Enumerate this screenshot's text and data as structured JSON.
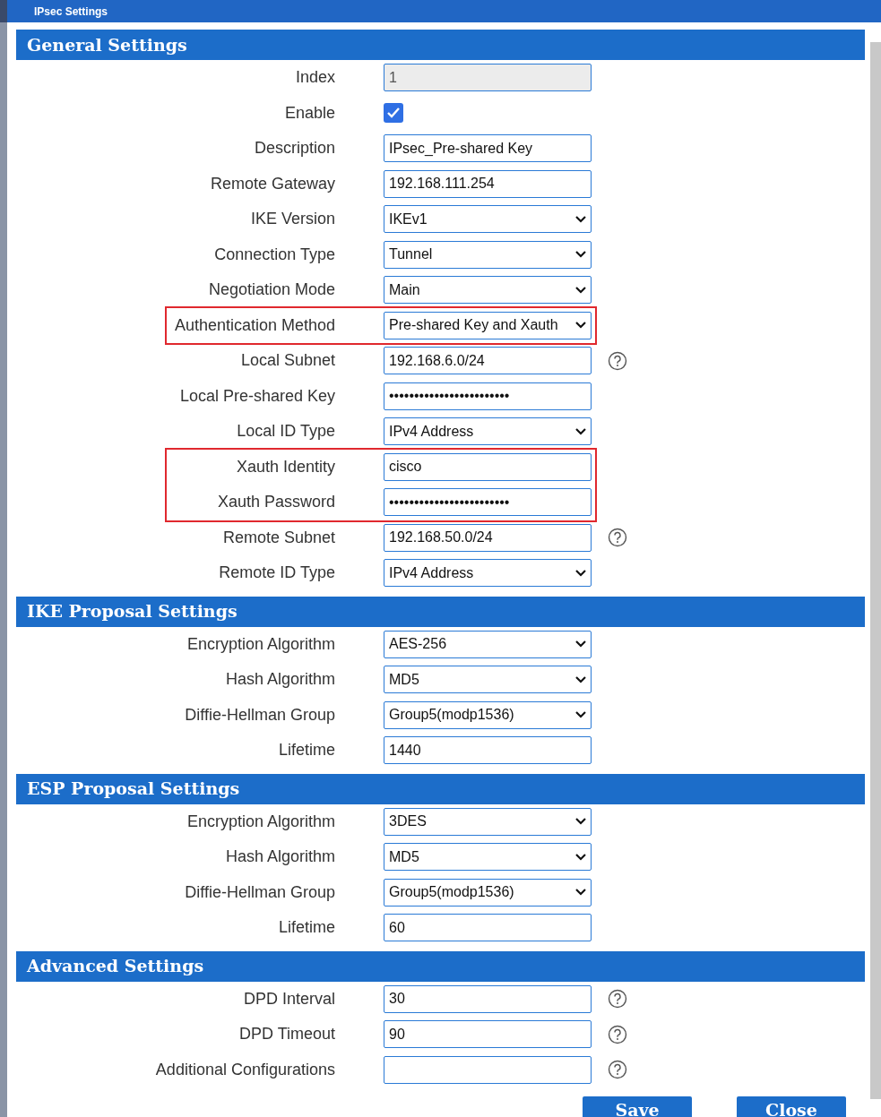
{
  "window": {
    "title": "IPsec Settings"
  },
  "sections": [
    {
      "title": "General Settings",
      "rows": [
        {
          "kind": "text",
          "label": "Index",
          "value": "1",
          "disabled": true
        },
        {
          "kind": "checkbox",
          "label": "Enable",
          "checked": true
        },
        {
          "kind": "text",
          "label": "Description",
          "value": "IPsec_Pre-shared Key"
        },
        {
          "kind": "text",
          "label": "Remote Gateway",
          "value": "192.168.111.254"
        },
        {
          "kind": "select",
          "label": "IKE Version",
          "value": "IKEv1"
        },
        {
          "kind": "select",
          "label": "Connection Type",
          "value": "Tunnel"
        },
        {
          "kind": "select",
          "label": "Negotiation Mode",
          "value": "Main"
        },
        {
          "kind": "group",
          "highlighted": true,
          "rows": [
            {
              "kind": "select",
              "label": "Authentication Method",
              "value": "Pre-shared Key and Xauth"
            }
          ]
        },
        {
          "kind": "text",
          "label": "Local Subnet",
          "value": "192.168.6.0/24",
          "help": true
        },
        {
          "kind": "password",
          "label": "Local Pre-shared Key",
          "value": "••••••••••••••••••••••••"
        },
        {
          "kind": "select",
          "label": "Local ID Type",
          "value": "IPv4 Address"
        },
        {
          "kind": "group",
          "highlighted": true,
          "rows": [
            {
              "kind": "text",
              "label": "Xauth Identity",
              "value": "cisco"
            },
            {
              "kind": "password",
              "label": "Xauth Password",
              "value": "••••••••••••••••••••••••"
            }
          ]
        },
        {
          "kind": "text",
          "label": "Remote Subnet",
          "value": "192.168.50.0/24",
          "help": true
        },
        {
          "kind": "select",
          "label": "Remote ID Type",
          "value": "IPv4 Address"
        }
      ]
    },
    {
      "title": "IKE Proposal Settings",
      "rows": [
        {
          "kind": "select",
          "label": "Encryption Algorithm",
          "value": "AES-256"
        },
        {
          "kind": "select",
          "label": "Hash Algorithm",
          "value": "MD5"
        },
        {
          "kind": "select",
          "label": "Diffie-Hellman Group",
          "value": "Group5(modp1536)"
        },
        {
          "kind": "text",
          "label": "Lifetime",
          "value": "1440"
        }
      ]
    },
    {
      "title": "ESP Proposal Settings",
      "rows": [
        {
          "kind": "select",
          "label": "Encryption Algorithm",
          "value": "3DES"
        },
        {
          "kind": "select",
          "label": "Hash Algorithm",
          "value": "MD5"
        },
        {
          "kind": "select",
          "label": "Diffie-Hellman Group",
          "value": "Group5(modp1536)"
        },
        {
          "kind": "text",
          "label": "Lifetime",
          "value": "60"
        }
      ]
    },
    {
      "title": "Advanced Settings",
      "rows": [
        {
          "kind": "text",
          "label": "DPD Interval",
          "value": "30",
          "help": true
        },
        {
          "kind": "text",
          "label": "DPD Timeout",
          "value": "90",
          "help": true
        },
        {
          "kind": "text",
          "label": "Additional Configurations",
          "help": true
        }
      ]
    }
  ],
  "buttons": [
    "Save",
    "Close"
  ]
}
